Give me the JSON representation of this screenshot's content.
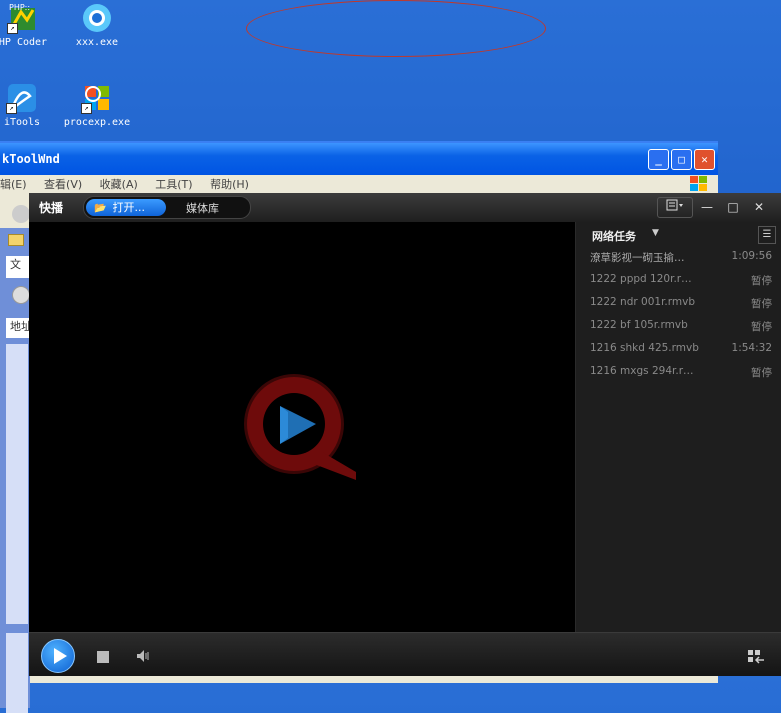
{
  "desktop": {
    "icons": [
      {
        "label": "HP Coder",
        "badge": "PHP::"
      },
      {
        "label": "xxx.exe"
      },
      {
        "label": "iTools"
      },
      {
        "label": "procexp.exe"
      }
    ]
  },
  "bg_window": {
    "title": "kToolWnd",
    "menu": [
      "辑(E)",
      "查看(V)",
      "收藏(A)",
      "工具(T)",
      "帮助(H)"
    ],
    "min": "_",
    "max": "□",
    "close": "✕",
    "left_labels": [
      "文",
      "地址"
    ]
  },
  "player": {
    "logo": "快播",
    "tabs": {
      "open": "打开...",
      "library": "媒体库"
    },
    "controls": {
      "min": "—",
      "max": "□",
      "close": "✕"
    },
    "panel": {
      "title": "网络任务",
      "tasks": [
        {
          "name": "潦草影视一砌玉揄…",
          "status": "1:09:56"
        },
        {
          "name": "1222 pppd 120r.r…",
          "status": "暂停"
        },
        {
          "name": "1222 ndr 001r.rmvb",
          "status": "暂停"
        },
        {
          "name": "1222 bf 105r.rmvb",
          "status": "暂停"
        },
        {
          "name": "1216 shkd 425.rmvb",
          "status": "1:54:32"
        },
        {
          "name": "1216 mxgs 294r.r…",
          "status": "暂停"
        }
      ]
    }
  },
  "colors": {
    "accent": "#1f78ff",
    "logo_red": "#7a1010",
    "logo_blue": "#1e6fb8"
  }
}
